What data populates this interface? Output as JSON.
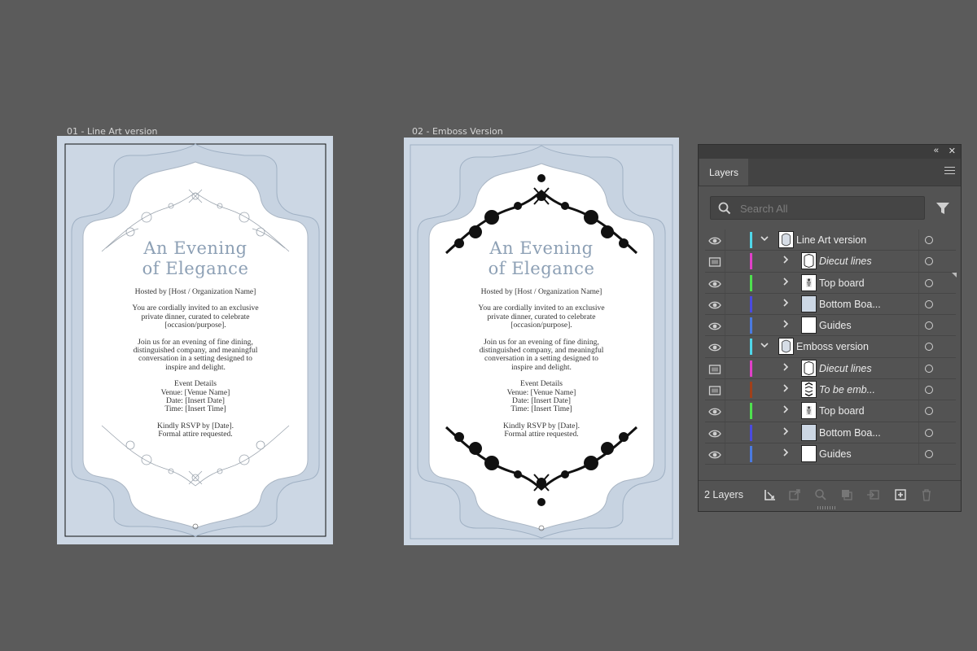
{
  "artboards": [
    {
      "label": "01 - Line Art version",
      "title_line1": "An Evening",
      "title_line2": "of Elegance",
      "hosted_by": "Hosted by [Host / Organization Name]",
      "para1": [
        "You are cordially invited to an exclusive",
        "private dinner, curated to celebrate",
        "[occasion/purpose]."
      ],
      "para2": [
        "Join us for an evening of fine dining,",
        "distinguished company, and meaningful",
        "conversation in a setting designed to",
        "inspire and delight."
      ],
      "details": [
        "Event Details",
        "Venue: [Venue Name]",
        "Date: [Insert Date]",
        "Time: [Insert Time]"
      ],
      "rsvp": [
        "Kindly RSVP by [Date].",
        "Formal attire requested."
      ]
    },
    {
      "label": "02 - Emboss Version",
      "title_line1": "An Evening",
      "title_line2": "of Elegance",
      "hosted_by": "Hosted by [Host / Organization Name]",
      "para1": [
        "You are cordially invited to an exclusive",
        "private dinner, curated to celebrate",
        "[occasion/purpose]."
      ],
      "para2": [
        "Join us for an evening of fine dining,",
        "distinguished company, and meaningful",
        "conversation in a setting designed to",
        "inspire and delight."
      ],
      "details": [
        "Event Details",
        "Venue: [Venue Name]",
        "Date: [Insert Date]",
        "Time: [Insert Time]"
      ],
      "rsvp": [
        "Kindly RSVP by [Date].",
        "Formal attire requested."
      ]
    }
  ],
  "layers_panel": {
    "collapse_icon": "double-chevron-left-icon",
    "close_icon": "close-icon",
    "tab_label": "Layers",
    "menu_icon": "hamburger-menu-icon",
    "search_placeholder": "Search All",
    "search_icon": "search-icon",
    "filter_icon": "filter-icon",
    "rows": [
      {
        "name": "Line Art version",
        "level": 0,
        "expanded": true,
        "italic": false,
        "visibility": "eye",
        "color": "#4fd6e8",
        "thumb": "card"
      },
      {
        "name": "Diecut lines",
        "level": 1,
        "expanded": false,
        "italic": true,
        "visibility": "template",
        "color": "#e040c8",
        "thumb": "frame"
      },
      {
        "name": "Top board",
        "level": 1,
        "expanded": false,
        "italic": false,
        "visibility": "eye",
        "color": "#4ee04e",
        "thumb": "topboard"
      },
      {
        "name": "Bottom Boa...",
        "level": 1,
        "expanded": false,
        "italic": false,
        "visibility": "eye",
        "color": "#4a4ae0",
        "thumb": "blue"
      },
      {
        "name": "Guides",
        "level": 1,
        "expanded": false,
        "italic": false,
        "visibility": "eye",
        "color": "#4a7ae0",
        "thumb": "white"
      },
      {
        "name": "Emboss version",
        "level": 0,
        "expanded": true,
        "italic": false,
        "visibility": "eye",
        "color": "#4fd6e8",
        "thumb": "card"
      },
      {
        "name": "Diecut lines",
        "level": 1,
        "expanded": false,
        "italic": true,
        "visibility": "template",
        "color": "#e040c8",
        "thumb": "frame"
      },
      {
        "name": "To be emb...",
        "level": 1,
        "expanded": false,
        "italic": true,
        "visibility": "template",
        "color": "#a0401a",
        "thumb": "emboss"
      },
      {
        "name": "Top board",
        "level": 1,
        "expanded": false,
        "italic": false,
        "visibility": "eye",
        "color": "#4ee04e",
        "thumb": "topboard"
      },
      {
        "name": "Bottom Boa...",
        "level": 1,
        "expanded": false,
        "italic": false,
        "visibility": "eye",
        "color": "#4a4ae0",
        "thumb": "blue"
      },
      {
        "name": "Guides",
        "level": 1,
        "expanded": false,
        "italic": false,
        "visibility": "eye",
        "color": "#4a7ae0",
        "thumb": "white"
      }
    ],
    "footer_count": "2 Layers",
    "footer_icons": [
      "collect-for-export-icon",
      "export-icon",
      "locate-object-icon",
      "clipping-mask-icon",
      "new-sublayer-icon",
      "new-layer-icon",
      "delete-icon"
    ]
  }
}
